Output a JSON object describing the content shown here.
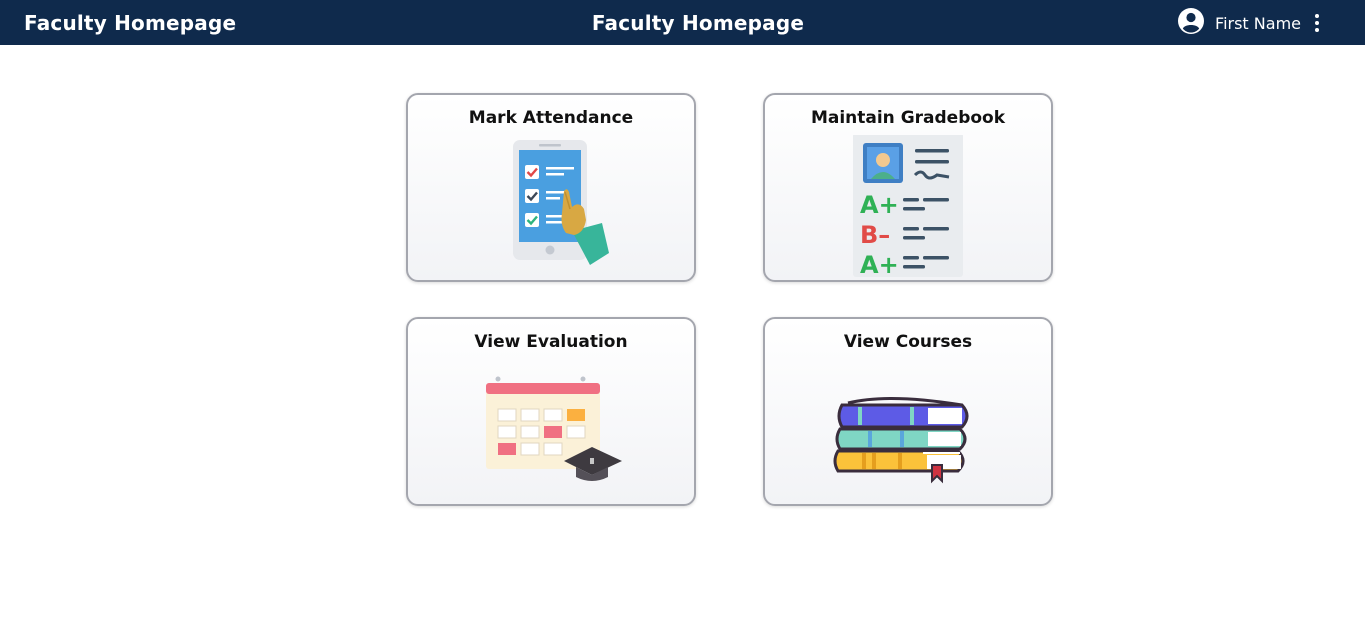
{
  "header": {
    "brand": "Faculty Homepage",
    "title": "Faculty Homepage",
    "user_name": "First Name",
    "user_icon": "account-circle-icon",
    "menu_icon": "more-vertical-icon",
    "background_color": "#0f2a4c"
  },
  "cards": [
    {
      "label": "Mark Attendance",
      "icon": "attendance-checklist-icon"
    },
    {
      "label": "Maintain Gradebook",
      "icon": "gradebook-report-icon"
    },
    {
      "label": "View Evaluation",
      "icon": "calendar-graduation-icon"
    },
    {
      "label": "View Courses",
      "icon": "book-stack-icon"
    }
  ]
}
